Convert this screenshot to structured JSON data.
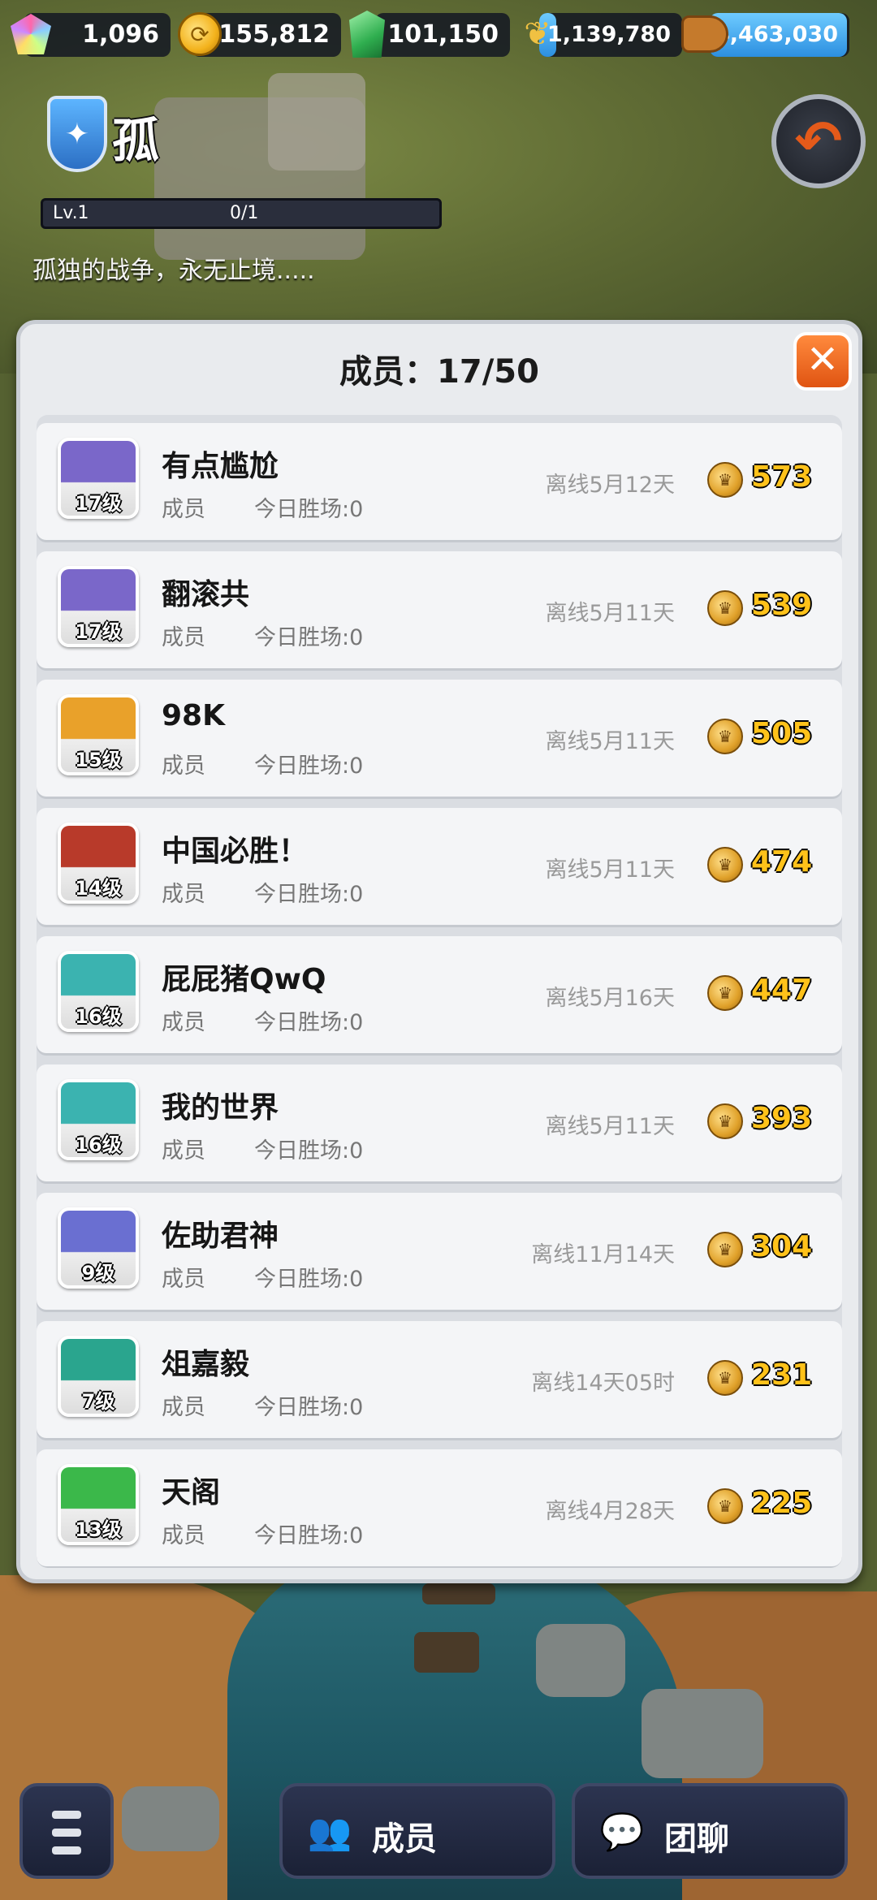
{
  "resources": [
    {
      "icon": "gem-icon",
      "value": "1,096",
      "kind": "gem"
    },
    {
      "icon": "gold-coin-icon",
      "value": "1,155,812",
      "kind": "coin"
    },
    {
      "icon": "jade-icon",
      "value": "101,150",
      "kind": "jade"
    },
    {
      "icon": "wheat-icon",
      "value": "1,139,780",
      "kind": "wheat"
    },
    {
      "icon": "wood-log-icon",
      "value": "4,463,030",
      "kind": "log"
    }
  ],
  "guild": {
    "name": "孤",
    "level": "Lv.1",
    "exp": "0/1",
    "motto": "孤独的战争，永无止境....."
  },
  "panel": {
    "title": "成员：17/50"
  },
  "members": [
    {
      "name": "有点尴尬",
      "role": "成员",
      "wins": "今日胜场:0",
      "offline": "离线5月12天",
      "score": "573",
      "level": "17级",
      "avatar": "purple-knight-avatar",
      "color": "#7a67c9"
    },
    {
      "name": "翻滚共",
      "role": "成员",
      "wins": "今日胜场:0",
      "offline": "离线5月11天",
      "score": "539",
      "level": "17级",
      "avatar": "purple-knight-avatar",
      "color": "#7a67c9"
    },
    {
      "name": "98K",
      "role": "成员",
      "wins": "今日胜场:0",
      "offline": "离线5月11天",
      "score": "505",
      "level": "15级",
      "avatar": "gray-helmet-avatar",
      "color": "#e9a12a"
    },
    {
      "name": "中国必胜！",
      "role": "成员",
      "wins": "今日胜场:0",
      "offline": "离线5月11天",
      "score": "474",
      "level": "14级",
      "avatar": "olive-helmet-avatar",
      "color": "#b83a2a"
    },
    {
      "name": "屁屁猪QwQ",
      "role": "成员",
      "wins": "今日胜场:0",
      "offline": "离线5月16天",
      "score": "447",
      "level": "16级",
      "avatar": "red-beard-avatar",
      "color": "#3bb3b0"
    },
    {
      "name": "我的世界",
      "role": "成员",
      "wins": "今日胜场:0",
      "offline": "离线5月11天",
      "score": "393",
      "level": "16级",
      "avatar": "red-beard-avatar",
      "color": "#3bb3b0"
    },
    {
      "name": "佐助君神",
      "role": "成员",
      "wins": "今日胜场:0",
      "offline": "离线11月14天",
      "score": "304",
      "level": "9级",
      "avatar": "blue-hood-avatar",
      "color": "#6a6fd1"
    },
    {
      "name": "俎嘉毅",
      "role": "成员",
      "wins": "今日胜场:0",
      "offline": "离线14天05时",
      "score": "231",
      "level": "7级",
      "avatar": "white-beard-avatar",
      "color": "#2aa58e"
    },
    {
      "name": "天阁",
      "role": "成员",
      "wins": "今日胜场:0",
      "offline": "离线4月28天",
      "score": "225",
      "level": "13级",
      "avatar": "panda-avatar",
      "color": "#3bb84a"
    }
  ],
  "bottom": {
    "members_label": "成员",
    "chat_label": "团聊"
  }
}
